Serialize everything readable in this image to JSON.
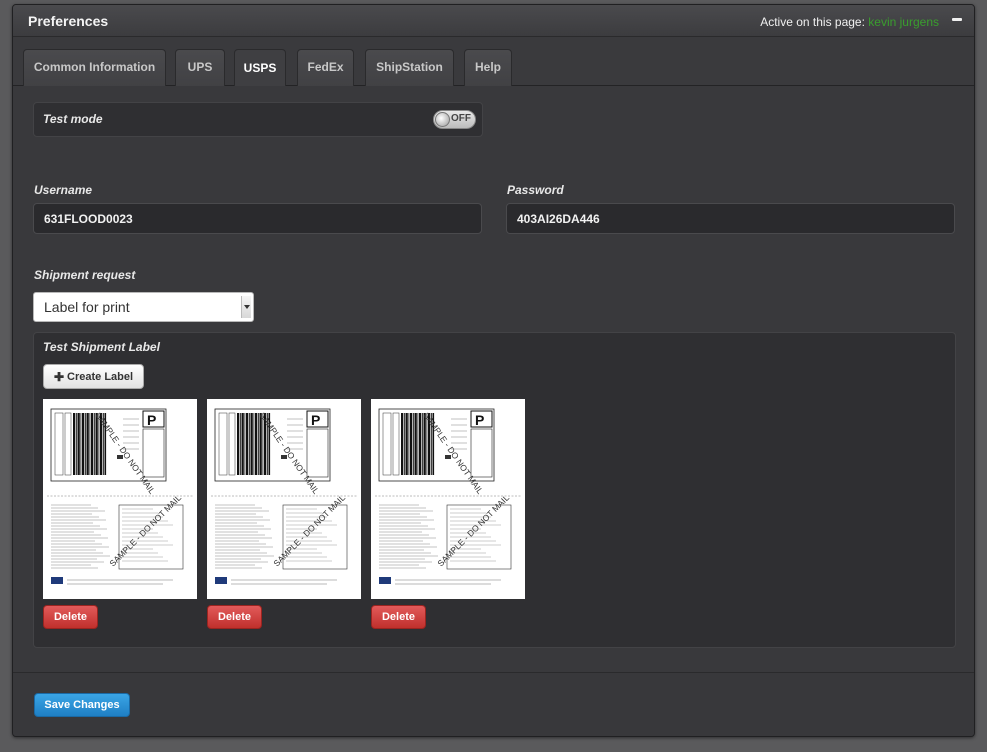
{
  "header": {
    "title": "Preferences",
    "active_label": "Active on this page:",
    "active_user": "kevin jurgens",
    "collapse_icon": "minus-icon"
  },
  "tabs": [
    {
      "label": "Common Information",
      "active": false
    },
    {
      "label": "UPS",
      "active": false
    },
    {
      "label": "USPS",
      "active": true
    },
    {
      "label": "FedEx",
      "active": false
    },
    {
      "label": "ShipStation",
      "active": false
    },
    {
      "label": "Help",
      "active": false
    }
  ],
  "test_mode": {
    "label": "Test mode",
    "toggle_state": "OFF"
  },
  "credentials": {
    "username_label": "Username",
    "username_value": "631FLOOD0023",
    "password_label": "Password",
    "password_value": "403AI26DA446"
  },
  "shipment_request": {
    "label": "Shipment request",
    "selected": "Label for print"
  },
  "test_label": {
    "title": "Test Shipment Label",
    "create_button": "Create Label",
    "create_icon": "plus-icon",
    "delete_label": "Delete",
    "sample_watermark": "SAMPLE - DO NOT MAIL",
    "thumbnail_count": 3
  },
  "footer": {
    "save_button": "Save Changes"
  },
  "colors": {
    "active_user": "#3a9e2e",
    "delete": "#c9302c",
    "save": "#2a8fd6"
  }
}
